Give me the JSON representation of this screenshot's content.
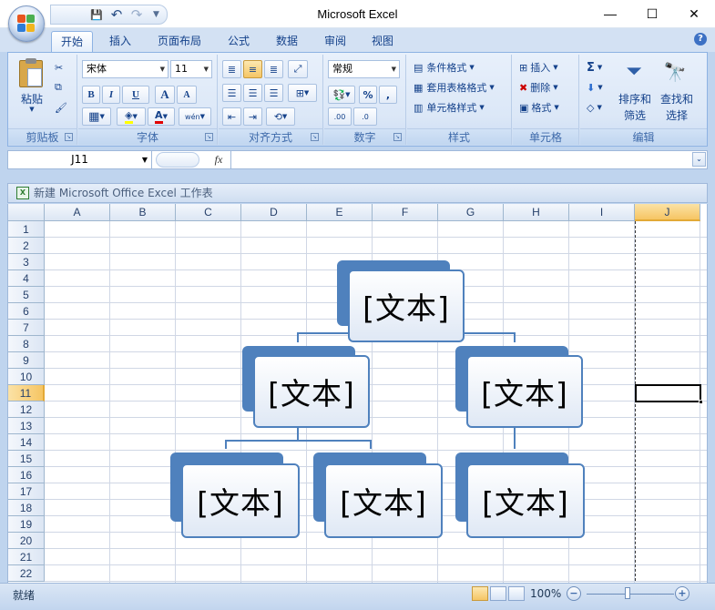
{
  "window": {
    "title": "Microsoft Excel",
    "minimize": "—",
    "maximize": "☐",
    "close": "✕"
  },
  "qat": {
    "save": "💾",
    "undo": "↶",
    "redo": "↷",
    "customize": "▼"
  },
  "tabs": [
    {
      "label": "开始",
      "active": true
    },
    {
      "label": "插入"
    },
    {
      "label": "页面布局"
    },
    {
      "label": "公式"
    },
    {
      "label": "数据"
    },
    {
      "label": "审阅"
    },
    {
      "label": "视图"
    }
  ],
  "help": "?",
  "ribbon": {
    "clipboard": {
      "label": "剪贴板",
      "paste": "粘贴"
    },
    "font": {
      "label": "字体",
      "name": "宋体",
      "size": "11",
      "bold": "B",
      "italic": "I",
      "underline": "U",
      "grow": "A",
      "shrink": "A",
      "wen": "wén"
    },
    "alignment": {
      "label": "对齐方式"
    },
    "number": {
      "label": "数字",
      "format": "常规",
      "percent": "%",
      "comma": ",",
      "inc": ".00→.0",
      "dec": ".0→.00"
    },
    "styles": {
      "label": "样式",
      "conditional": "条件格式",
      "table": "套用表格格式",
      "cell": "单元格样式"
    },
    "cells": {
      "label": "单元格",
      "insert": "插入",
      "delete": "删除",
      "format": "格式"
    },
    "editing": {
      "label": "编辑",
      "sigma": "Σ",
      "sort": "排序和",
      "sort2": "筛选",
      "find": "查找和",
      "find2": "选择"
    }
  },
  "formula_bar": {
    "name_box": "J11",
    "fx": "fx",
    "value": ""
  },
  "workbook": {
    "title": "新建 Microsoft Office Excel 工作表"
  },
  "columns": [
    "A",
    "B",
    "C",
    "D",
    "E",
    "F",
    "G",
    "H",
    "I",
    "J"
  ],
  "rows": [
    "1",
    "2",
    "3",
    "4",
    "5",
    "6",
    "7",
    "8",
    "9",
    "10",
    "11",
    "12",
    "13",
    "14",
    "15",
    "16",
    "17",
    "18",
    "19",
    "20",
    "21",
    "22"
  ],
  "selected": {
    "column": "J",
    "row": "11"
  },
  "smartart": {
    "nodes": [
      "[文本]",
      "[文本]",
      "[文本]",
      "[文本]",
      "[文本]",
      "[文本]"
    ]
  },
  "status": {
    "ready": "就绪",
    "zoom": "100%",
    "minus": "−",
    "plus": "+"
  },
  "colors": {
    "accent": "#4f81bd",
    "ribbon": "#dbe7f7",
    "selected_header": "#f6c563"
  }
}
